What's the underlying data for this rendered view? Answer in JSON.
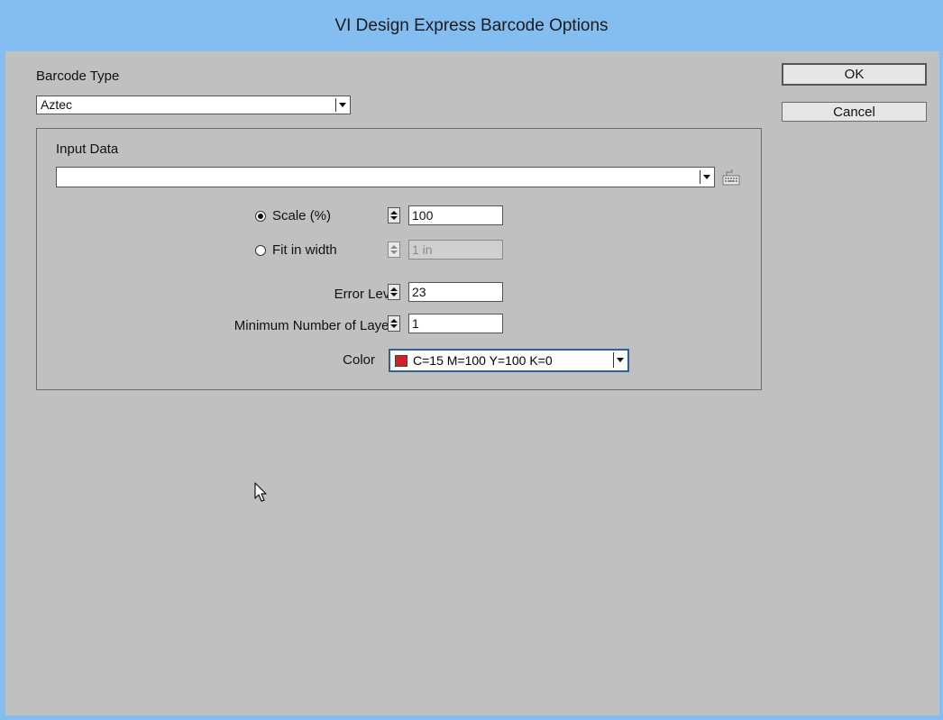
{
  "window": {
    "title": "VI Design Express Barcode Options"
  },
  "barcode_type": {
    "label": "Barcode Type",
    "value": "Aztec"
  },
  "buttons": {
    "ok": "OK",
    "cancel": "Cancel"
  },
  "input_data": {
    "label": "Input Data",
    "value": ""
  },
  "scale": {
    "label": "Scale (%)",
    "value": "100",
    "selected": true
  },
  "fit_in_width": {
    "label": "Fit in width",
    "value": "1 in",
    "selected": false
  },
  "error_level": {
    "label": "Error Level",
    "value": "23"
  },
  "min_layers": {
    "label": "Minimum Number of Layers",
    "value": "1"
  },
  "color": {
    "label": "Color",
    "value": "C=15 M=100 Y=100 K=0",
    "swatch": "#d0202a"
  },
  "icons": {
    "keyboard": "keyboard-icon",
    "cursor": "mouse-cursor-icon"
  },
  "colors": {
    "title_bar": "#84bdf0",
    "dialog_bg": "#c0c0c0"
  }
}
